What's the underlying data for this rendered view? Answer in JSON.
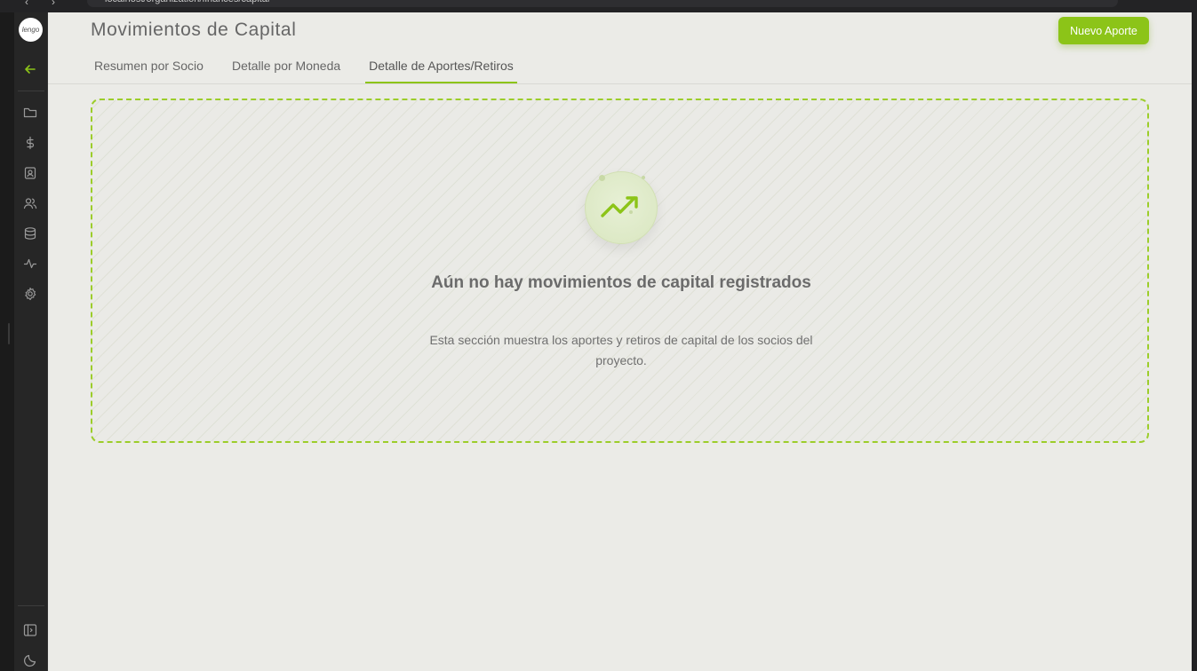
{
  "browser": {
    "url": "localhost/organization/finances/capital"
  },
  "sidebar": {
    "logo_text": "lengo",
    "items": [
      {
        "icon": "arrow-left-icon"
      },
      {
        "icon": "folder-icon"
      },
      {
        "icon": "dollar-icon"
      },
      {
        "icon": "contact-card-icon"
      },
      {
        "icon": "users-icon"
      },
      {
        "icon": "database-icon"
      },
      {
        "icon": "activity-icon"
      },
      {
        "icon": "gear-icon"
      },
      {
        "icon": "sidebar-panel-icon"
      },
      {
        "icon": "moon-icon"
      }
    ]
  },
  "header": {
    "title": "Movimientos de Capital",
    "primary_action": "Nuevo Aporte"
  },
  "tabs": [
    {
      "label": "Resumen por Socio",
      "active": false
    },
    {
      "label": "Detalle por Moneda",
      "active": false
    },
    {
      "label": "Detalle de Aportes/Retiros",
      "active": true
    }
  ],
  "empty_state": {
    "icon": "trending-up-icon",
    "title": "Aún no hay movimientos de capital registrados",
    "description": "Esta sección muestra los aportes y retiros de capital de los socios del proyecto."
  },
  "colors": {
    "accent": "#8cc418",
    "background": "#ebebe7",
    "sidebar": "#262626"
  }
}
